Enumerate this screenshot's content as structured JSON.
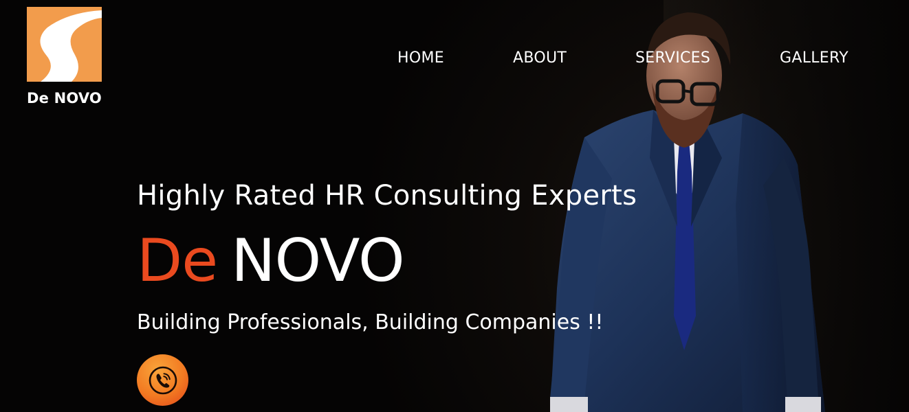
{
  "logo": {
    "text": "De NOVO",
    "mark_color": "#f29c4c"
  },
  "nav": {
    "items": [
      {
        "label": "HOME"
      },
      {
        "label": "ABOUT"
      },
      {
        "label": "SERVICES"
      },
      {
        "label": "GALLERY"
      }
    ]
  },
  "hero": {
    "headline": "Highly Rated HR Consulting Experts",
    "brand_first": "De",
    "brand_second": "NOVO",
    "brand_accent_color": "#ea4a1f",
    "tagline": "Building Professionals, Building Companies !!",
    "call_icon": "phone-icon"
  }
}
